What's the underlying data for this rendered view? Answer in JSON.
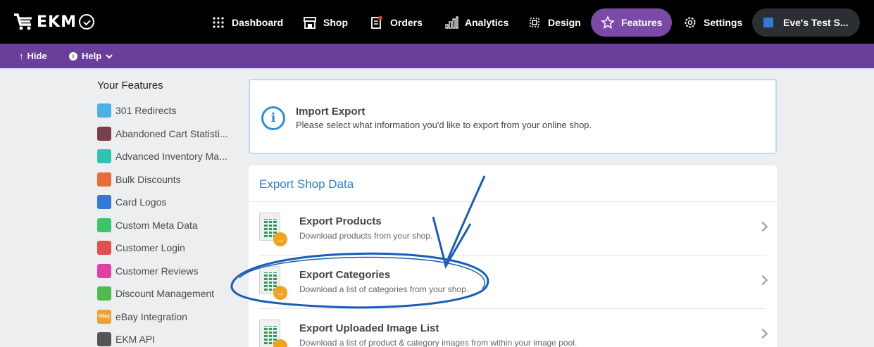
{
  "topnav": {
    "logo_text": "EKM",
    "items": [
      {
        "label": "Dashboard",
        "icon": "grid-dots-icon"
      },
      {
        "label": "Shop",
        "icon": "storefront-icon"
      },
      {
        "label": "Orders",
        "icon": "orders-icon"
      },
      {
        "label": "Analytics",
        "icon": "bar-chart-icon"
      },
      {
        "label": "Design",
        "icon": "design-icon"
      },
      {
        "label": "Features",
        "icon": "star-icon",
        "active": true
      },
      {
        "label": "Settings",
        "icon": "gear-icon"
      }
    ],
    "shop_button": "Eve's Test S..."
  },
  "subbar": {
    "hide_label": "Hide",
    "help_label": "Help"
  },
  "sidebar": {
    "title": "Your Features",
    "items": [
      {
        "label": "301 Redirects",
        "color": "#4ab0e6"
      },
      {
        "label": "Abandoned Cart Statisti...",
        "color": "#7a3e4c"
      },
      {
        "label": "Advanced Inventory Ma...",
        "color": "#2ec4b0"
      },
      {
        "label": "Bulk Discounts",
        "color": "#e86b3a"
      },
      {
        "label": "Card Logos",
        "color": "#2e7cd6"
      },
      {
        "label": "Custom Meta Data",
        "color": "#3cc46a"
      },
      {
        "label": "Customer Login",
        "color": "#e24f4f"
      },
      {
        "label": "Customer Reviews",
        "color": "#e23fa4"
      },
      {
        "label": "Discount Management",
        "color": "#4cbc4c"
      },
      {
        "label": "eBay Integration",
        "color": "#f0a030",
        "icon_text": "ebay"
      },
      {
        "label": "EKM API",
        "color": "#555555"
      }
    ]
  },
  "info_card": {
    "title": "Import Export",
    "description": "Please select what information you'd like to export from your online shop."
  },
  "export": {
    "title": "Export Shop Data",
    "rows": [
      {
        "title": "Export Products",
        "description": "Download products from your shop."
      },
      {
        "title": "Export Categories",
        "description": "Download a list of categories from your shop."
      },
      {
        "title": "Export Uploaded Image List",
        "description": "Download a list of product & category images from within your image pool."
      }
    ]
  },
  "colors": {
    "nav_bg": "#000000",
    "subbar_bg": "#6a3f9b",
    "features_active": "#7b4aa8",
    "link_blue": "#2e7cd6",
    "annotation_blue": "#1a5db8"
  }
}
